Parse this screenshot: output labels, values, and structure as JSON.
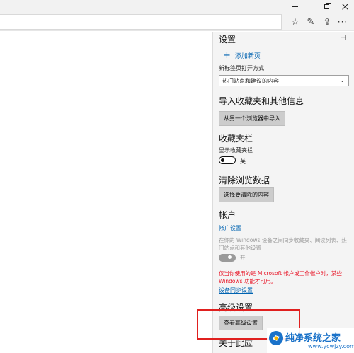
{
  "window": {
    "icons": [
      "minimize-icon",
      "maximize-icon",
      "close-icon"
    ]
  },
  "toolbar": {
    "icons": [
      "favorites-star-icon",
      "pen-notes-icon",
      "share-icon",
      "more-icon"
    ],
    "more_glyph": "···",
    "fav_glyph": "☆",
    "notes_glyph": "✎",
    "share_glyph": "⇪"
  },
  "settings": {
    "title": "设置",
    "pin_glyph": "⊣",
    "add_new_page": "添加新页",
    "new_tab_label": "新标签页打开方式",
    "new_tab_value": "热门站点和建议的内容",
    "import_title": "导入收藏夹和其他信息",
    "import_button": "从另一个浏览器中导入",
    "favbar_title": "收藏夹栏",
    "show_favbar_label": "显示收藏夹栏",
    "show_favbar_state": "关",
    "clear_title": "清除浏览数据",
    "clear_button": "选择要清除的内容",
    "account_title": "帐户",
    "account_link": "帐户设置",
    "sync_description": "在你的 Windows 设备之间同步收藏夹、阅读列表、热门站点和其他设置",
    "sync_state": "开",
    "warning": "仅当你使用的是 Microsoft 帐户或工作帐户时，某些 Windows 功能才可用。",
    "device_sync_link": "设备同步设置",
    "advanced_title": "高级设置",
    "advanced_button": "查看高级设置",
    "about_title": "关于此应"
  },
  "watermark": {
    "brand": "纯净系统之家",
    "url": "www.ycwjzy.com"
  },
  "colors": {
    "accent": "#0063b1",
    "warning": "#e81123",
    "highlight_box": "#e0201f",
    "panel_bg": "#f4f4f4"
  }
}
